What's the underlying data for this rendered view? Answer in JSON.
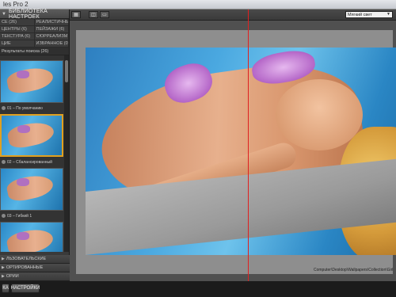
{
  "window": {
    "title": "les Pro 2"
  },
  "left_panel": {
    "library_title": "БИБЛИОТЕКА НАСТРОЕК",
    "categories": [
      "СЕ (26)",
      "РЕАЛИСТИЧНЫЕ (26)",
      "ЦЕНТРЫ (6)",
      "ПЕЙЗАЖИ (6)",
      "ТЕКСТУРА (6)",
      "СЮРРЕАЛИЗМ (6)",
      "ЦИЕ",
      "ИЗБРАННОЕ (0)"
    ],
    "results_title": "Результаты поиска (26)",
    "thumbnails": [
      {
        "label": "01 – По умолчанию",
        "selected": false
      },
      {
        "label": "02 – Сбалансированный",
        "selected": true
      },
      {
        "label": "03 – Гибкий 1",
        "selected": false
      },
      {
        "label": "",
        "selected": false
      }
    ],
    "bottom_categories": [
      "ЛЬЗОВАТЕЛЬСКИЕ",
      "ОРТИРОВАННЫЕ",
      "ОРИИ"
    ]
  },
  "bottom_bar": {
    "left_button": "КА",
    "settings_button": "НАСТРОЙКИ"
  },
  "main": {
    "toolbar_buttons": [
      "grid-icon",
      "split-view-icon",
      "side-by-side-icon"
    ],
    "preset_dropdown": "Мягкий свет",
    "caption": "Computer\\Desktop\\Wallpapers\\Collection\\Girl"
  }
}
